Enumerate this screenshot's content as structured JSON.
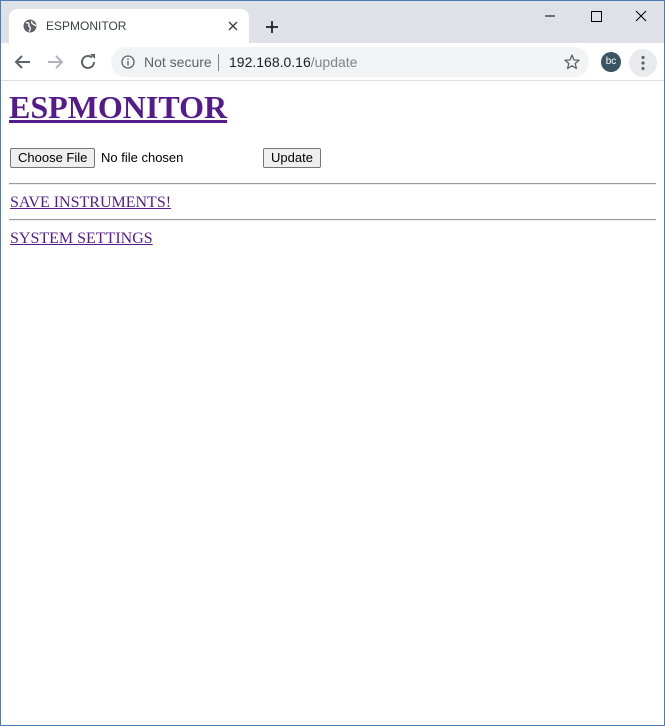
{
  "browser": {
    "tab": {
      "title": "ESPMONITOR",
      "favicon_icon": "globe-icon",
      "close_icon": "close-icon"
    },
    "new_tab_icon": "plus-icon",
    "window_controls": [
      "minimize-icon",
      "maximize-icon",
      "close-icon"
    ],
    "toolbar": {
      "security_label": "Not secure",
      "url_host": "192.168.0.16",
      "url_path": "/update",
      "profile_initials": "bc"
    }
  },
  "page": {
    "title": "ESPMONITOR",
    "file_input": {
      "button_label": "Choose File",
      "status_text": "No file chosen"
    },
    "update_button_label": "Update",
    "links": {
      "save_instruments": "SAVE INSTRUMENTS!",
      "system_settings": "SYSTEM SETTINGS"
    }
  },
  "colors": {
    "visited_link": "#551a8b",
    "tabstrip_bg": "#dee1e6",
    "omnibox_bg": "#f1f3f4",
    "avatar_bg": "#3b5362"
  }
}
